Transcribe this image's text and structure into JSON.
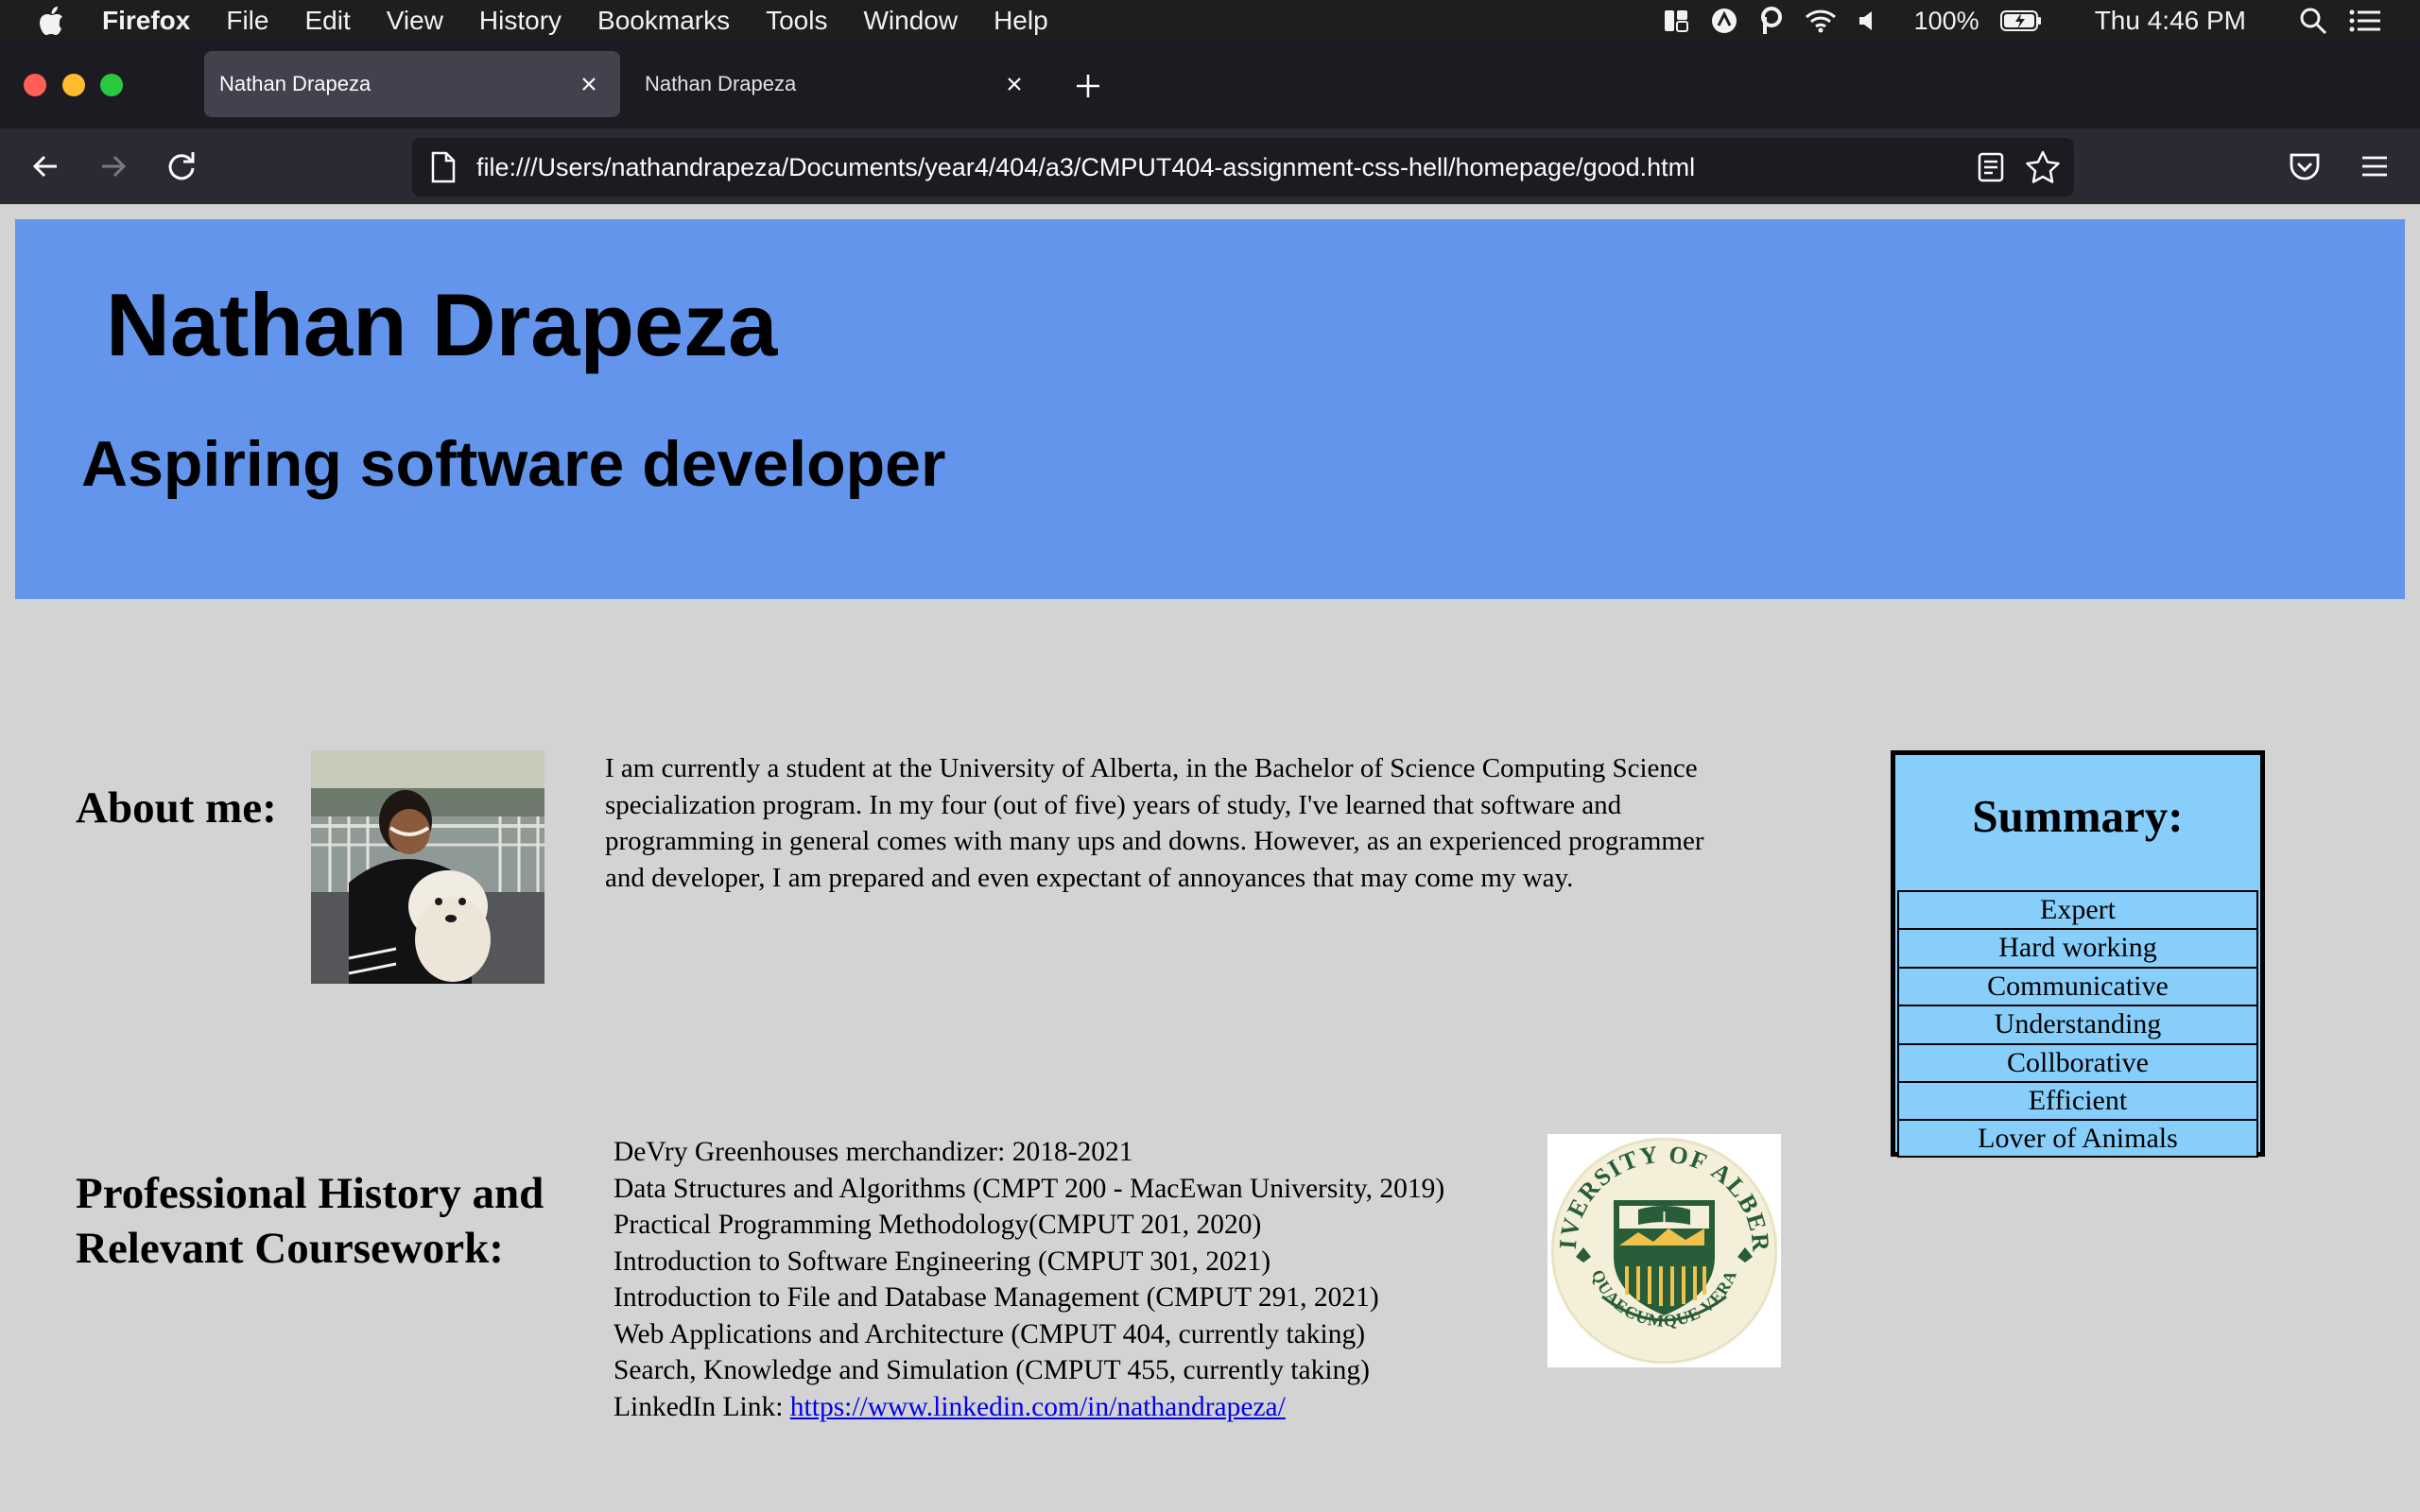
{
  "menubar": {
    "app_name": "Firefox",
    "items": [
      "File",
      "Edit",
      "View",
      "History",
      "Bookmarks",
      "Tools",
      "Window",
      "Help"
    ],
    "battery": "100%",
    "clock": "Thu 4:46 PM"
  },
  "tabs": [
    {
      "title": "Nathan Drapeza",
      "active": true
    },
    {
      "title": "Nathan Drapeza",
      "active": false
    }
  ],
  "urlbar": {
    "url": "file:///Users/nathandrapeza/Documents/year4/404/a3/CMPUT404-assignment-css-hell/homepage/good.html"
  },
  "page": {
    "title": "Nathan Drapeza",
    "subtitle": "Aspiring software developer",
    "about": {
      "heading": "About me:",
      "text": "I am currently a student at the University of Alberta, in the Bachelor of Science Computing Science specialization program. In my four (out of five) years of study, I've learned that software and programming in general comes with many ups and downs. However, as an experienced programmer and developer, I am prepared and even expectant of annoyances that may come my way."
    },
    "summary": {
      "title": "Summary:",
      "items": [
        "Expert",
        "Hard working",
        "Communicative",
        "Understanding",
        "Collborative",
        "Efficient",
        "Lover of Animals"
      ]
    },
    "professional": {
      "heading": "Professional History and Relevant Coursework:",
      "items": [
        "DeVry Greenhouses merchandizer: 2018-2021",
        "Data Structures and Algorithms (CMPT 200 - MacEwan University, 2019)",
        "Practical Programming Methodology(CMPUT 201, 2020)",
        "Introduction to Software Engineering (CMPUT 301, 2021)",
        "Introduction to File and Database Management (CMPUT 291, 2021)",
        "Web Applications and Architecture (CMPUT 404, currently taking)",
        "Search, Knowledge and Simulation (CMPUT 455, currently taking)"
      ],
      "linkedin_label": "LinkedIn Link:",
      "linkedin_url": "https://www.linkedin.com/in/nathandrapeza/"
    },
    "logo_text": {
      "top": "UNIVERSITY OF ALBERTA",
      "bottom": "QUAECUMQUE VERA"
    }
  },
  "colors": {
    "header_band": "#6495ed",
    "page_bg": "#d3d3d3",
    "summary_bg": "#87cefa",
    "link": "#0000ee"
  }
}
